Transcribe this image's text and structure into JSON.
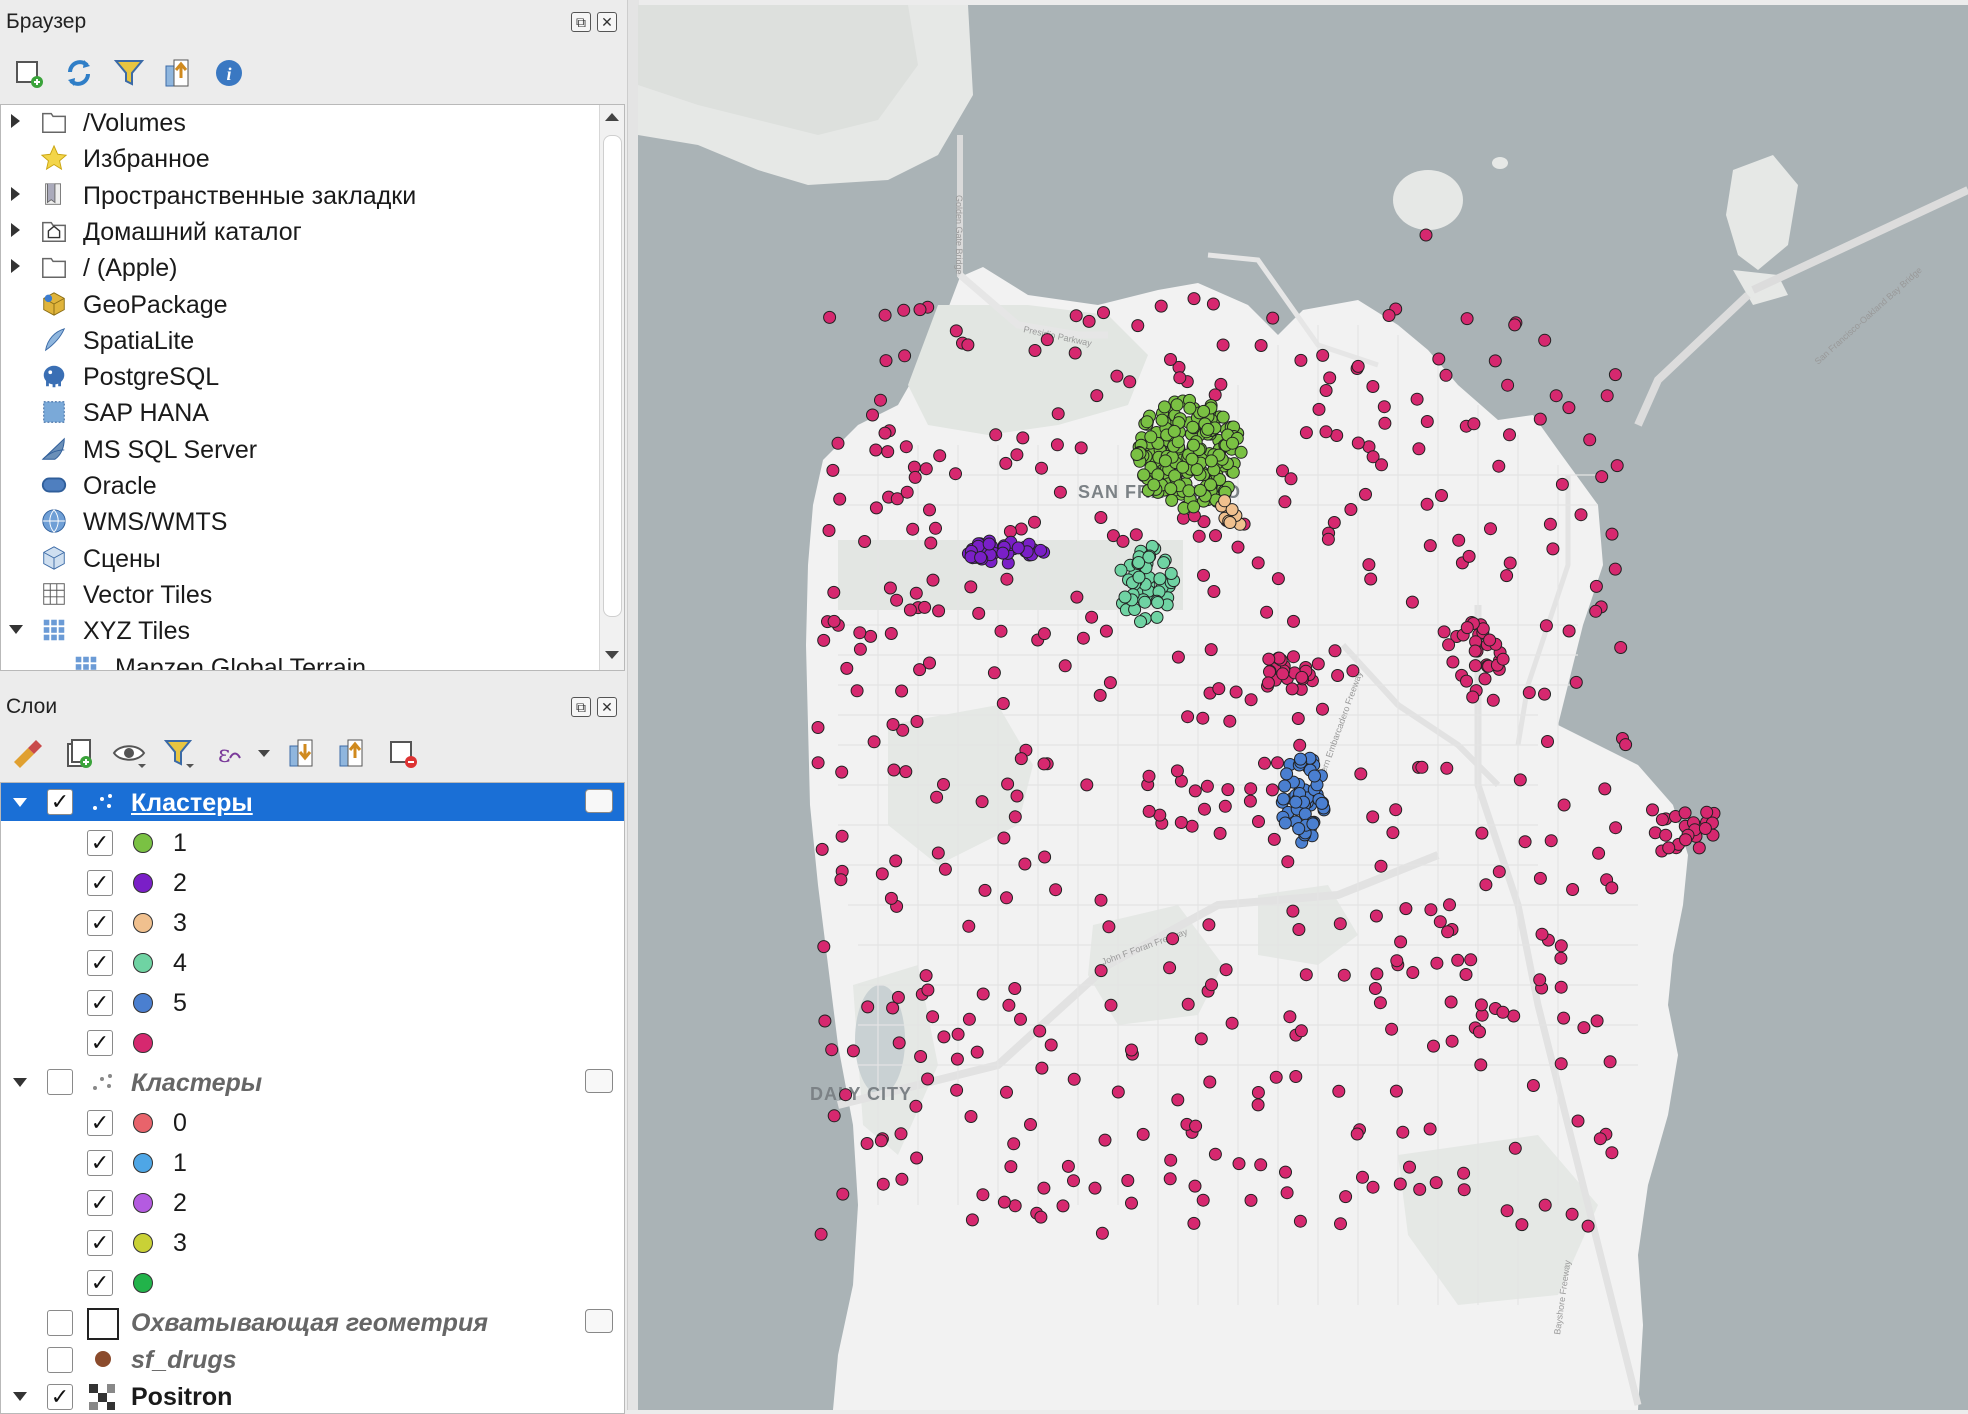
{
  "browser_panel": {
    "title": "Браузер",
    "items": [
      {
        "label": "/Volumes",
        "icon": "folder-icon",
        "expander": "collapsed"
      },
      {
        "label": "Избранное",
        "icon": "star-icon",
        "expander": "none"
      },
      {
        "label": "Пространственные закладки",
        "icon": "bookmarks-icon",
        "expander": "collapsed"
      },
      {
        "label": "Домашний каталог",
        "icon": "home-folder-icon",
        "expander": "collapsed"
      },
      {
        "label": "/ (Apple)",
        "icon": "folder-icon",
        "expander": "collapsed"
      },
      {
        "label": "GeoPackage",
        "icon": "geopackage-icon",
        "expander": "none"
      },
      {
        "label": "SpatiaLite",
        "icon": "spatialite-icon",
        "expander": "none"
      },
      {
        "label": "PostgreSQL",
        "icon": "postgresql-icon",
        "expander": "none"
      },
      {
        "label": "SAP HANA",
        "icon": "sap-hana-icon",
        "expander": "none"
      },
      {
        "label": "MS SQL Server",
        "icon": "mssql-icon",
        "expander": "none"
      },
      {
        "label": "Oracle",
        "icon": "oracle-icon",
        "expander": "none"
      },
      {
        "label": "WMS/WMTS",
        "icon": "globe-icon",
        "expander": "none"
      },
      {
        "label": "Сцены",
        "icon": "cube-icon",
        "expander": "none"
      },
      {
        "label": "Vector Tiles",
        "icon": "grid-icon",
        "expander": "none"
      },
      {
        "label": "XYZ Tiles",
        "icon": "grid-icon",
        "expander": "expanded"
      },
      {
        "label": "Mapzen Global Terrain",
        "icon": "grid-icon",
        "expander": "child"
      }
    ]
  },
  "layers_panel": {
    "title": "Слои",
    "groups": [
      {
        "label": "Кластеры",
        "checked": true,
        "selected": true,
        "style": "selected",
        "classes": [
          {
            "label": "1",
            "color": "#7ac143"
          },
          {
            "label": "2",
            "color": "#7a1fc7"
          },
          {
            "label": "3",
            "color": "#f0c08e"
          },
          {
            "label": "4",
            "color": "#6fd3a3"
          },
          {
            "label": "5",
            "color": "#4a7fd0"
          },
          {
            "label": "",
            "color": "#d6286f"
          }
        ]
      },
      {
        "label": "Кластеры",
        "checked": false,
        "selected": false,
        "style": "italic",
        "classes": [
          {
            "label": "0",
            "color": "#e8636b"
          },
          {
            "label": "1",
            "color": "#4ea6e6"
          },
          {
            "label": "2",
            "color": "#b45be0"
          },
          {
            "label": "3",
            "color": "#c9d136"
          },
          {
            "label": "",
            "color": "#22b34a"
          }
        ]
      }
    ],
    "extra_layers": [
      {
        "label": "Охватывающая геометрия",
        "checked": false,
        "style": "italic"
      },
      {
        "label": "sf_drugs",
        "checked": false,
        "style": "italic"
      },
      {
        "label": "Positron",
        "checked": true,
        "style": "bold"
      }
    ]
  },
  "map": {
    "labels": {
      "city": "SAN FRANCISCO",
      "daly": "DALY CITY",
      "presidio": "Presidio Parkway",
      "golden_gate": "Golden Gate Bridge",
      "bay_bridge": "San Francisco-Oakland Bay Bridge",
      "foran": "John F Foran Freeway",
      "bayshore": "Bayshore Freeway",
      "hwy": "Southern Embarcadero Freeway"
    },
    "colors": {
      "water": "#aab3b6",
      "land": "#f2f2f2",
      "park": "#e3e6e3",
      "noise": "#d6286f",
      "c1": "#7ac143",
      "c2": "#7a1fc7",
      "c3": "#f0c08e",
      "c4": "#6fd3a3",
      "c5": "#4a7fd0"
    }
  }
}
